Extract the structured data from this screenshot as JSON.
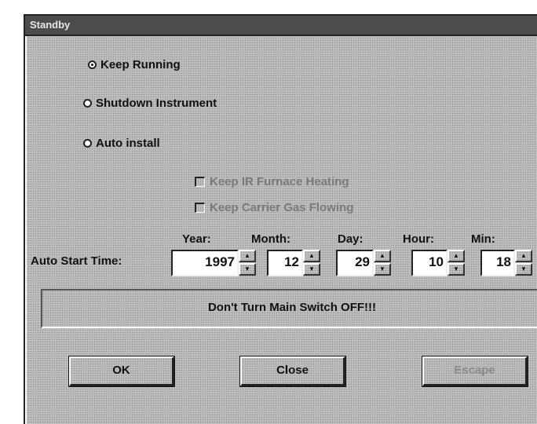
{
  "window": {
    "title": "Standby"
  },
  "options": [
    {
      "label": "Keep Running",
      "selected": true
    },
    {
      "label": "Shutdown Instrument",
      "selected": false
    },
    {
      "label": "Auto install",
      "selected": false
    }
  ],
  "checkboxes": [
    {
      "label": "Keep IR Furnace Heating",
      "checked": false,
      "enabled": false
    },
    {
      "label": "Keep Carrier Gas Flowing",
      "checked": false,
      "enabled": false
    }
  ],
  "auto_start": {
    "label": "Auto Start Time:",
    "headers": {
      "year": "Year:",
      "month": "Month:",
      "day": "Day:",
      "hour": "Hour:",
      "min": "Min:"
    },
    "values": {
      "year": "1997",
      "month": "12",
      "day": "29",
      "hour": "10",
      "min": "18"
    }
  },
  "warning": "Don't Turn Main Switch OFF!!!",
  "buttons": {
    "ok": "OK",
    "close": "Close",
    "escape": "Escape"
  },
  "icons": {
    "spin_up": "spin-up-icon",
    "spin_down": "spin-down-icon"
  }
}
